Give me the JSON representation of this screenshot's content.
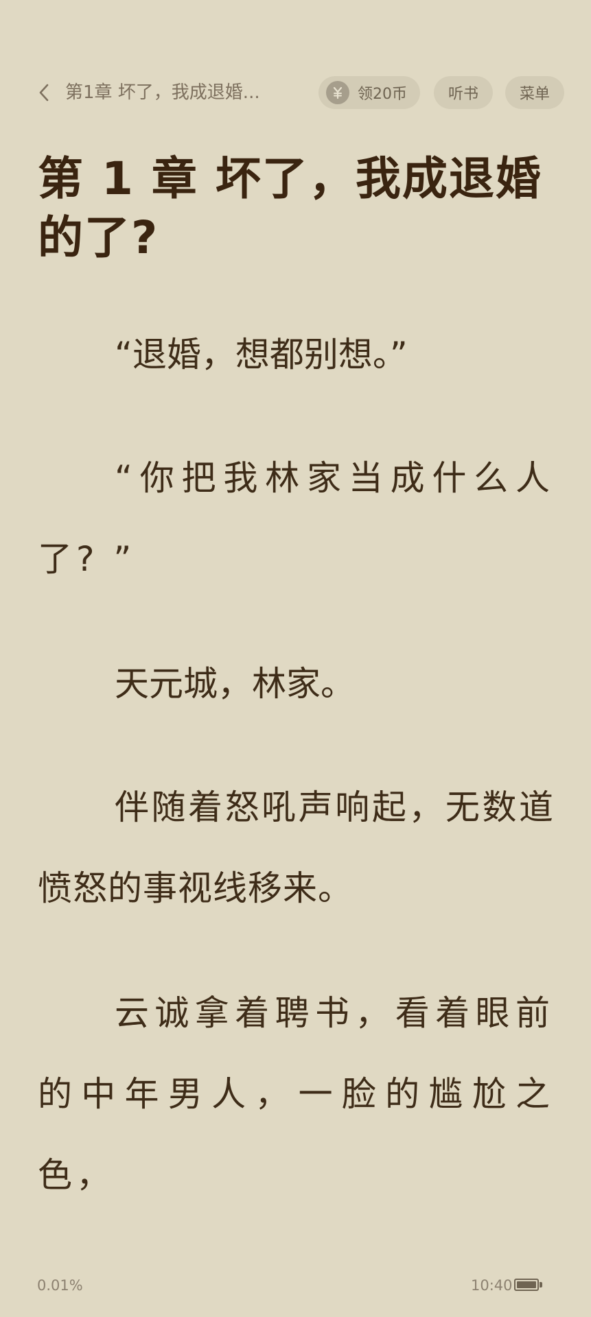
{
  "topbar": {
    "back_icon": "chevron-left-icon",
    "chapter_short": "第1章 坏了，我成退婚...",
    "coins_icon": "yuan-coin-icon",
    "coins_label": "领20币",
    "listen_label": "听书",
    "menu_label": "菜单"
  },
  "chapter": {
    "title": "第 1 章 坏了，我成退婚的了?"
  },
  "paragraphs": [
    "“退婚，想都别想。”",
    "“你把我林家当成什么人了? ”",
    "天元城，林家。",
    "伴随着怒吼声响起，无数道愤怒的事视线移来。",
    "云诚拿着聘书，看着眼前的中年男人，一脸的尴尬之色，"
  ],
  "status": {
    "progress": "0.01%",
    "time": "10:40",
    "battery_icon": "battery-icon",
    "battery_level": 1.0
  },
  "colors": {
    "background": "#e0d9c3",
    "pill": "#d3ccb6",
    "text": "#3e2c18",
    "muted": "#8c8170"
  }
}
